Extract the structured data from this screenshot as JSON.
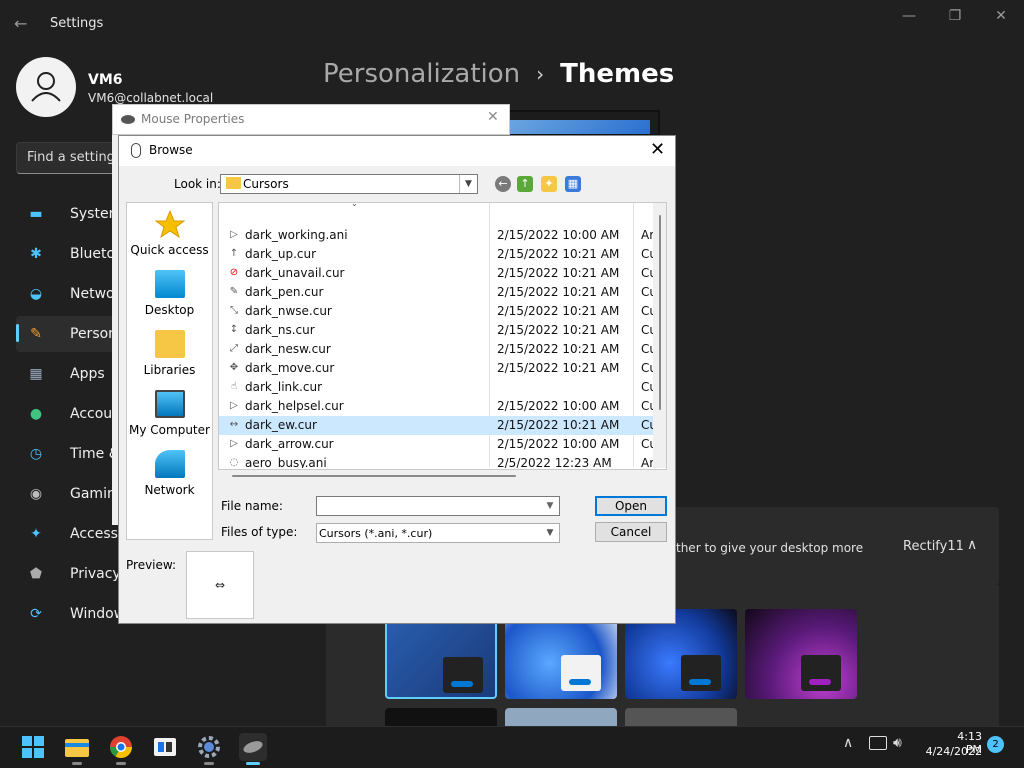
{
  "settings": {
    "app_title": "Settings",
    "user": {
      "name": "VM6",
      "email": "VM6@collabnet.local"
    },
    "search_placeholder": "Find a setting",
    "nav": [
      {
        "label": "System",
        "icon": "monitor-icon"
      },
      {
        "label": "Bluetoot",
        "icon": "bluetooth-icon"
      },
      {
        "label": "Network",
        "icon": "wifi-icon"
      },
      {
        "label": "Personal",
        "icon": "brush-icon"
      },
      {
        "label": "Apps",
        "icon": "apps-icon"
      },
      {
        "label": "Account",
        "icon": "person-icon"
      },
      {
        "label": "Time & l",
        "icon": "clock-icon"
      },
      {
        "label": "Gaming",
        "icon": "gamepad-icon"
      },
      {
        "label": "Accessib",
        "icon": "accessibility-icon"
      },
      {
        "label": "Privacy &",
        "icon": "shield-icon"
      },
      {
        "label": "Windows",
        "icon": "update-icon"
      }
    ],
    "breadcrumb": {
      "parent": "Personalization",
      "separator": "›",
      "current": "Themes"
    },
    "rectify": {
      "text": "ther to give your desktop more",
      "label": "Rectify11"
    }
  },
  "mouse_properties": {
    "title": "Mouse Properties"
  },
  "browse": {
    "title": "Browse",
    "look_in_label": "Look in:",
    "look_in_value": "Cursors",
    "places": [
      {
        "label": "Quick access",
        "icon": "star-icon"
      },
      {
        "label": "Desktop",
        "icon": "desktop-icon"
      },
      {
        "label": "Libraries",
        "icon": "folder-icon"
      },
      {
        "label": "My Computer",
        "icon": "computer-icon"
      },
      {
        "label": "Network",
        "icon": "network-icon"
      }
    ],
    "files": [
      {
        "name": "dark_working.ani",
        "date": "2/15/2022 10:00 AM",
        "type": "Ar"
      },
      {
        "name": "dark_up.cur",
        "date": "2/15/2022 10:21 AM",
        "type": "Cu"
      },
      {
        "name": "dark_unavail.cur",
        "date": "2/15/2022 10:21 AM",
        "type": "Cu"
      },
      {
        "name": "dark_pen.cur",
        "date": "2/15/2022 10:21 AM",
        "type": "Cu"
      },
      {
        "name": "dark_nwse.cur",
        "date": "2/15/2022 10:21 AM",
        "type": "Cu"
      },
      {
        "name": "dark_ns.cur",
        "date": "2/15/2022 10:21 AM",
        "type": "Cu"
      },
      {
        "name": "dark_nesw.cur",
        "date": "2/15/2022 10:21 AM",
        "type": "Cu"
      },
      {
        "name": "dark_move.cur",
        "date": "2/15/2022 10:21 AM",
        "type": "Cu"
      },
      {
        "name": "dark_link.cur",
        "date": "",
        "type": "Cu"
      },
      {
        "name": "dark_helpsel.cur",
        "date": "2/15/2022 10:00 AM",
        "type": "Cu"
      },
      {
        "name": "dark_ew.cur",
        "date": "2/15/2022 10:21 AM",
        "type": "Cu"
      },
      {
        "name": "dark_arrow.cur",
        "date": "2/15/2022 10:00 AM",
        "type": "Cu"
      },
      {
        "name": "aero_busy.ani",
        "date": "2/5/2022 12:23 AM",
        "type": "Ar"
      }
    ],
    "selected_index": 10,
    "file_name_label": "File name:",
    "file_name_value": "",
    "files_of_type_label": "Files of type:",
    "files_of_type_value": "Cursors (*.ani, *.cur)",
    "open_label": "Open",
    "cancel_label": "Cancel",
    "preview_label": "Preview:",
    "preview_glyph": "⇔"
  },
  "taskbar": {
    "time": "4:13 PM",
    "date": "4/24/2022",
    "notifications": "2",
    "apps": [
      "windows-start-icon",
      "file-explorer-icon",
      "chrome-icon",
      "store-icon",
      "settings-icon",
      "mouse-properties-icon"
    ]
  },
  "colors": {
    "accent": "#60cdff",
    "selection": "#cce8ff",
    "folder": "#f6c744"
  }
}
